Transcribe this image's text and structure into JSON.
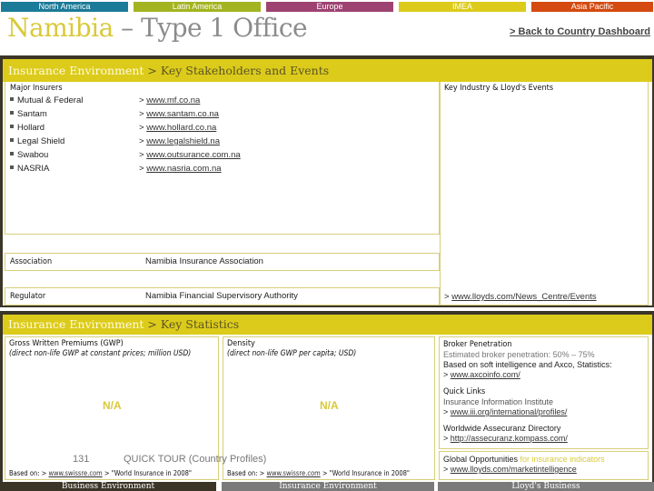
{
  "regions": [
    {
      "label": "North America",
      "color": "#1b7b98"
    },
    {
      "label": "Latin America",
      "color": "#a3b420"
    },
    {
      "label": "Europe",
      "color": "#9e4371"
    },
    {
      "label": "IMEA",
      "color": "#dccb1a"
    },
    {
      "label": "Asia Pacific",
      "color": "#d44a10"
    }
  ],
  "header": {
    "country": "Namibia",
    "rest": " – Type 1 Office",
    "back_link": "> Back to Country Dashboard"
  },
  "stakeholders": {
    "header_l1": "Insurance Environment ",
    "header_l2": " > Key Stakeholders and Events",
    "major_insurers_label": "Major Insurers",
    "insurers": [
      {
        "name": "Mutual & Federal",
        "url": "www.mf.co.na"
      },
      {
        "name": "Santam",
        "url": "www.santam.co.na"
      },
      {
        "name": "Hollard",
        "url": "www.hollard.co.na"
      },
      {
        "name": "Legal Shield",
        "url": "www.legalshield.na"
      },
      {
        "name": "Swabou",
        "url": "www.outsurance.com.na"
      },
      {
        "name": "NASRIA",
        "url": "www.nasria.com.na"
      }
    ],
    "url_prefix": "> ",
    "association_label": "Association",
    "association_value": "Namibia Insurance Association",
    "regulator_label": "Regulator",
    "regulator_value": "Namibia Financial Supervisory Authority",
    "events_label": "Key Industry & Lloyd's Events",
    "events_link": "www.lloyds.com/News_Centre/Events"
  },
  "statistics": {
    "header_l1": "Insurance Environment",
    "header_l2": " > Key Statistics",
    "gwp_title": "Gross Written Premiums (GWP)",
    "gwp_subtitle": "(direct non-life GWP at constant prices; million USD)",
    "gwp_value": "N/A",
    "density_title": "Density",
    "density_subtitle": "(direct non-life GWP per capita; USD)",
    "density_value": "N/A",
    "source_prefix": "Based on: > ",
    "source_link": "www.swissre.com",
    "source_suffix": " > \"World Insurance in 2008\"",
    "broker_title": "Broker Penetration",
    "broker_value": "Estimated broker penetration: 50% – 75%",
    "broker_basis": "Based on soft intelligence and Axco, Statistics:",
    "broker_link": "www.axcoinfo.com/",
    "quick_links_title": "Quick Links",
    "iii_label": "Insurance Information Institute",
    "iii_link": "www.iii.org/international/profiles/",
    "wad_label": "Worldwide Assecuranz Directory",
    "wad_link": "http://assecuranz.kompass.com/",
    "global_l1": "Global Opportunities",
    "global_l2": " for insurance indicators",
    "global_link": "www.lloyds.com/marketintelligence"
  },
  "footer": {
    "page_number": "131",
    "page_caption": "QUICK TOUR (Country Profiles)",
    "tabs": [
      {
        "label": "Business Environment",
        "color": "#3b3528"
      },
      {
        "label": "Insurance Environment",
        "color": "#7a7a7a"
      },
      {
        "label": "Lloyd's Business",
        "color": "#7a7a7a"
      }
    ]
  }
}
